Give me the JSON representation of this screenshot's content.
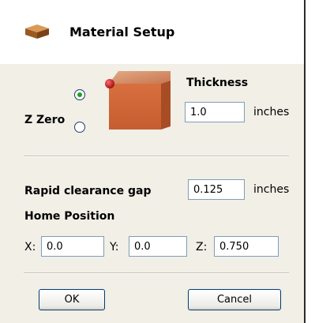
{
  "dialog": {
    "title": "Material Setup",
    "icon": "material-block-icon"
  },
  "z_zero": {
    "label": "Z Zero",
    "selected": "top"
  },
  "thickness": {
    "label": "Thickness",
    "value": "1.0",
    "unit": "inches"
  },
  "rapid_clearance": {
    "label": "Rapid clearance gap",
    "value": "0.125",
    "unit": "inches"
  },
  "home_position": {
    "label": "Home Position",
    "x_label": "X:",
    "x_value": "0.0",
    "y_label": "Y:",
    "y_value": "0.0",
    "z_label": "Z:",
    "z_value": "0.750"
  },
  "buttons": {
    "ok": "OK",
    "cancel": "Cancel"
  },
  "colors": {
    "panel": "#f1efe6",
    "radio_dot": "#21a121",
    "marker_red": "#c8141c",
    "block": "#c9643a"
  }
}
